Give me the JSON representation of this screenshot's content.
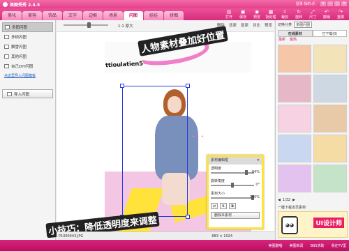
{
  "app": {
    "title": "美图秀秀 2.4.5",
    "user": "登录  我的:乐"
  },
  "window_controls": [
    "▾",
    "—",
    "□",
    "✕"
  ],
  "tabs": [
    {
      "label": "美化"
    },
    {
      "label": "美容"
    },
    {
      "label": "饰品"
    },
    {
      "label": "文字"
    },
    {
      "label": "边框"
    },
    {
      "label": "场景"
    },
    {
      "label": "闪图"
    },
    {
      "label": "娃娃"
    },
    {
      "label": "拼图"
    }
  ],
  "active_tab": "场景",
  "toolbar": [
    {
      "label": "打开",
      "icon": "folder-icon"
    },
    {
      "label": "保存",
      "icon": "save-icon"
    },
    {
      "label": "预览",
      "icon": "preview-icon"
    },
    {
      "label": "批处理",
      "icon": "batch-icon"
    },
    {
      "label": "裁剪",
      "icon": "crop-icon"
    },
    {
      "label": "旋转",
      "icon": "rotate-icon"
    },
    {
      "label": "尺寸",
      "icon": "resize-icon"
    },
    {
      "label": "撤销",
      "icon": "undo-icon"
    },
    {
      "label": "重做",
      "icon": "redo-icon"
    }
  ],
  "left_panel": {
    "items": [
      "多图闪图",
      "多帧闪图",
      "飘雪闪图",
      "其他闪图",
      "自己DIY闪图"
    ],
    "link": "点这里导入闪图模板",
    "import_button": "导入闪图"
  },
  "editor": {
    "zoom_label": "1:1 原大",
    "tools": [
      "删除",
      "还原",
      "复原",
      "对比",
      "预览"
    ],
    "watermark_text": "ttioulatien5",
    "callout_top": "人物素材叠加好位置",
    "callout_bottom": "小技巧：降低透明度来调整",
    "status_file": "P1000443.JPG",
    "status_size": "683 × 1024"
  },
  "popup": {
    "title": "素材编辑框",
    "close": "✕",
    "rows": [
      {
        "label": "透明度",
        "value": "84%",
        "level": 0.84
      },
      {
        "label": "旋转角度",
        "value": "0°",
        "level": 0.5
      },
      {
        "label": "素材大小",
        "value": "100%",
        "level": 1.0
      }
    ],
    "delete_button": "删除本素材"
  },
  "right_panel": {
    "category_label": "切换分类",
    "category_value": "多图闪图",
    "tabs": [
      "在线素材",
      "已下载(0)"
    ],
    "subtabs": [
      "最新",
      "最热"
    ],
    "thumb_colors": [
      "#f6c6a9",
      "#f3e3b8",
      "#e6b7c7",
      "#ced8e3",
      "#f7d2e2",
      "#e8c9a8",
      "#c9d8f0",
      "#f4dca4",
      "#e4c2f0",
      "#c4e3c9"
    ],
    "pager": "1/32",
    "download_text": "一键下载本页素材",
    "ad_text": "UI设计师"
  },
  "footer": {
    "links": [
      "美图翻唱",
      "美图新闻",
      "BBS求助",
      "我在TV里"
    ]
  }
}
